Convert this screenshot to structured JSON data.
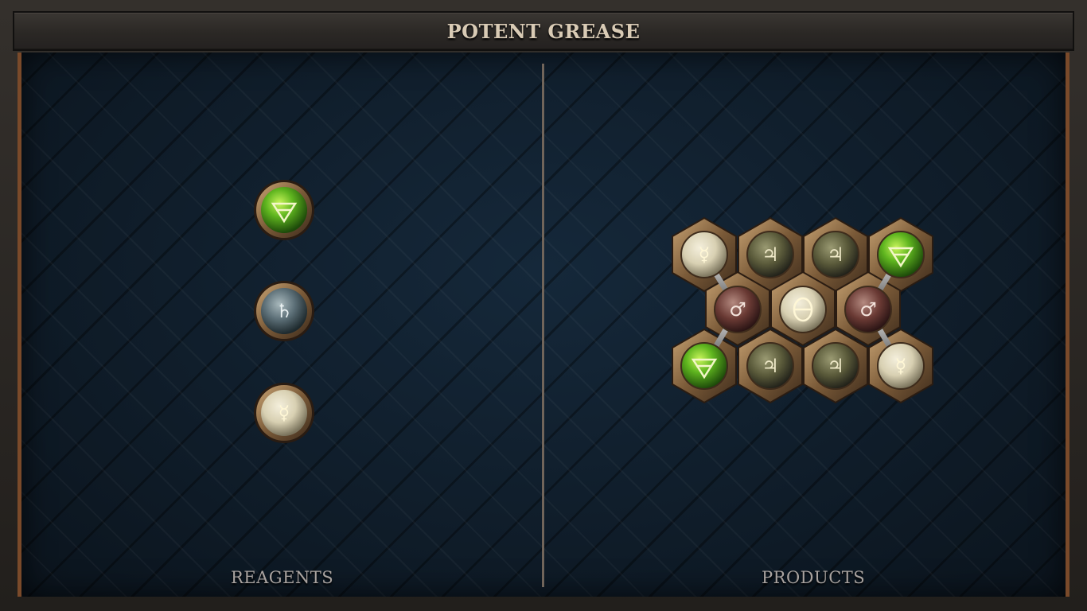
{
  "title": "POTENT GREASE",
  "panels": {
    "reagents_label": "REAGENTS",
    "products_label": "PRODUCTS"
  },
  "colors": {
    "salt_green": "#5fb51f",
    "lead_grey": "#5d7078",
    "quicksilver_cream": "#d8d0b2",
    "tin_olive": "#5a5a3a",
    "iron_red": "#6a3a34",
    "salt_cream": "#d6cdb0",
    "brass": "#8a6a44"
  },
  "reagents": [
    {
      "element": "salt",
      "icon": "salt-icon",
      "glyph": "🜔"
    },
    {
      "element": "lead",
      "icon": "lead-icon",
      "glyph": "♄"
    },
    {
      "element": "quicksilver",
      "icon": "quicksilver-icon",
      "glyph": "☿"
    }
  ],
  "products": {
    "atoms": [
      {
        "element": "quicksilver",
        "glyph": "☿"
      },
      {
        "element": "tin",
        "glyph": "♃"
      },
      {
        "element": "tin",
        "glyph": "♃"
      },
      {
        "element": "salt",
        "glyph": "🜔"
      },
      {
        "element": "iron",
        "glyph": "♂"
      },
      {
        "element": "salt-cardinal",
        "glyph": "🜔"
      },
      {
        "element": "iron",
        "glyph": "♂"
      },
      {
        "element": "salt",
        "glyph": "🜔"
      },
      {
        "element": "tin",
        "glyph": "♃"
      },
      {
        "element": "tin",
        "glyph": "♃"
      },
      {
        "element": "quicksilver",
        "glyph": "☿"
      }
    ]
  }
}
